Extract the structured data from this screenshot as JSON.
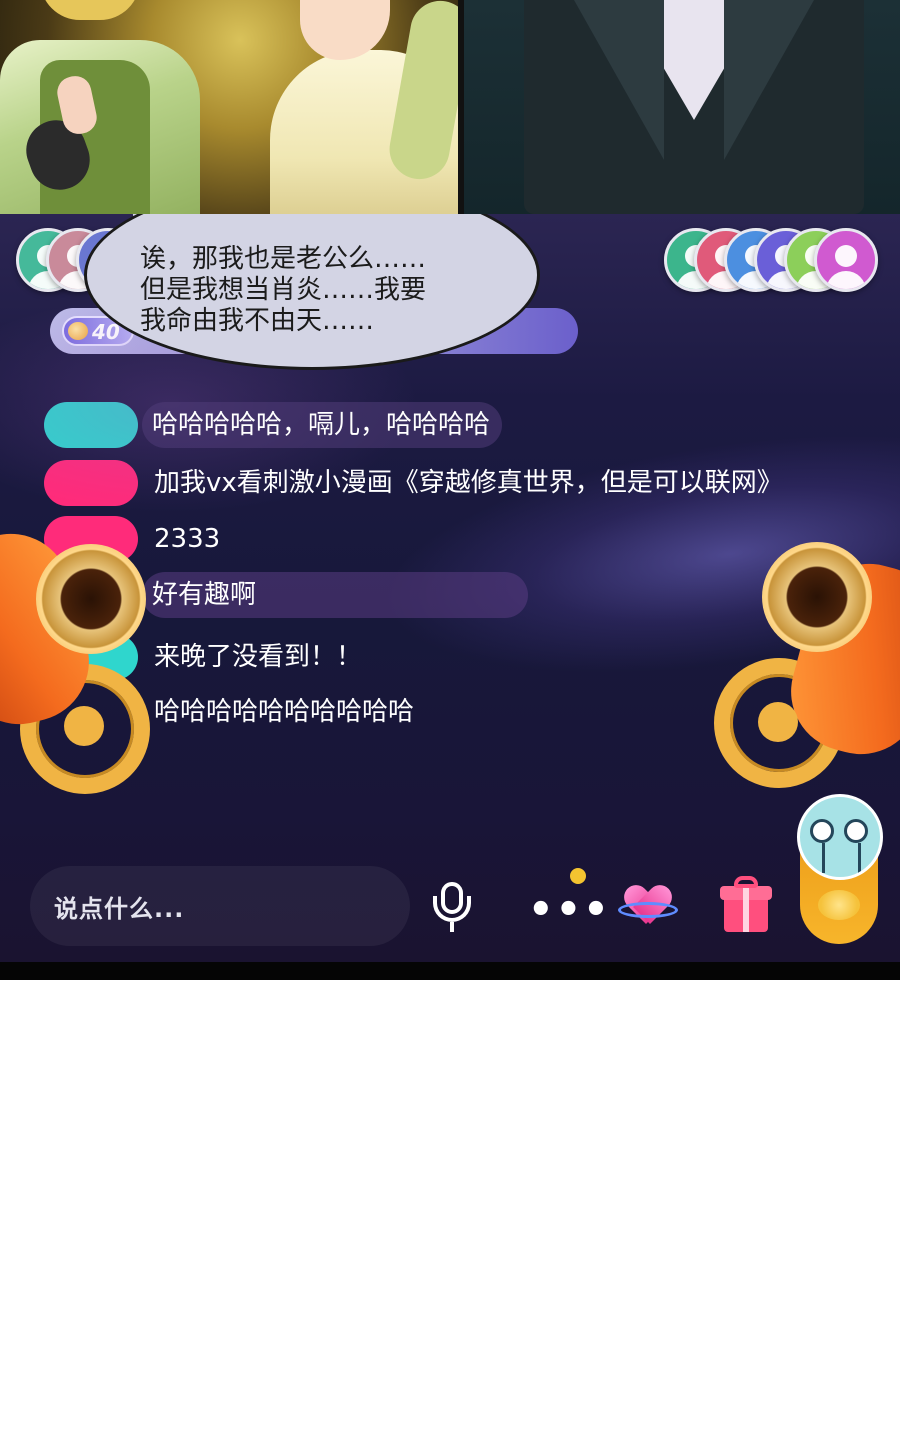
{
  "speech_bubble": {
    "lines": [
      "诶，那我也是老公么……",
      "但是我想当肖炎……我要",
      "我命由我不由天……"
    ]
  },
  "level_badge": {
    "value": "40"
  },
  "chat": {
    "messages": [
      {
        "text": "哈哈哈哈哈，嗝儿，哈哈哈哈",
        "tag_color": "#2fd6cd"
      },
      {
        "text": "加我vx看刺激小漫画《穿越修真世界，但是可以联网》",
        "tag_color": "#ff2b7a"
      },
      {
        "text": "2333",
        "tag_color": "#ff2b7a"
      },
      {
        "text": "好有趣啊",
        "tag_color": "#ff2b7a"
      },
      {
        "text": "来晚了没看到！！",
        "tag_color": "#2fd6cd"
      },
      {
        "text": "哈哈哈哈哈哈哈哈哈哈",
        "tag_color": ""
      }
    ]
  },
  "viewers": {
    "left_colors": [
      "#45b99a",
      "#c98a9a",
      "#6a77d1",
      "#b6b0e8",
      "#c8b2de",
      "#e1a7c4",
      "#9ec7a8",
      "#c9a0e0"
    ],
    "right_colors": [
      "#3cb58c",
      "#e05a7a",
      "#4c8fe0",
      "#6a5fd8",
      "#8ccf5a",
      "#d05ad0"
    ]
  },
  "bottom_bar": {
    "input_placeholder": "说点什么...",
    "icons": [
      "microphone-icon",
      "more-icon",
      "heart-planet-icon",
      "gift-icon",
      "fan-club-icon"
    ],
    "accent": "#f4c430"
  }
}
